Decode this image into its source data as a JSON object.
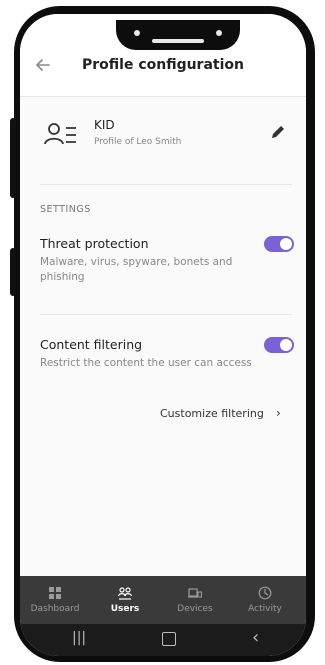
{
  "header": {
    "title": "Profile configuration",
    "back_icon": "arrow-left-icon"
  },
  "profile": {
    "name": "KID",
    "subtitle": "Profile of Leo Smith",
    "avatar_icon": "user-list-icon",
    "edit_icon": "pencil-icon"
  },
  "settings": {
    "section_label": "SETTINGS",
    "threat": {
      "title": "Threat protection",
      "description": "Malware, virus, spyware, bonets and phishing",
      "enabled": true
    },
    "content": {
      "title": "Content filtering",
      "description": "Restrict the content the user can access",
      "enabled": true
    },
    "customize": {
      "label": "Customize filtering",
      "arrow": "›"
    }
  },
  "tabs": [
    {
      "label": "Dashboard",
      "icon": "dashboard-grid-icon",
      "active": false
    },
    {
      "label": "Users",
      "icon": "users-icon",
      "active": true
    },
    {
      "label": "Devices",
      "icon": "devices-icon",
      "active": false
    },
    {
      "label": "Activity",
      "icon": "clock-icon",
      "active": false
    }
  ],
  "colors": {
    "accent": "#7b61d6",
    "tabbar": "#3a3a3a",
    "navbar": "#1b1b1b"
  }
}
